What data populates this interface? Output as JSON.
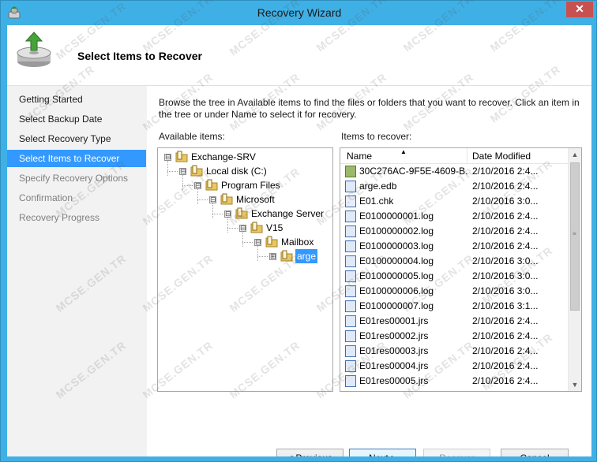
{
  "window": {
    "title": "Recovery Wizard",
    "close_symbol": "✕"
  },
  "header": {
    "title": "Select Items to Recover"
  },
  "nav": {
    "items": [
      {
        "label": "Getting Started",
        "state": "normal"
      },
      {
        "label": "Select Backup Date",
        "state": "normal"
      },
      {
        "label": "Select Recovery Type",
        "state": "normal"
      },
      {
        "label": "Select Items to Recover",
        "state": "active"
      },
      {
        "label": "Specify Recovery Options",
        "state": "disabled"
      },
      {
        "label": "Confirmation",
        "state": "disabled"
      },
      {
        "label": "Recovery Progress",
        "state": "disabled"
      }
    ]
  },
  "main": {
    "description": "Browse the tree in Available items to find the files or folders that you want to recover. Click an item in the tree or under Name to select it for recovery.",
    "available_label": "Available items:",
    "recover_label": "Items to recover:"
  },
  "tree": {
    "nodes": [
      {
        "label": "Exchange-SRV",
        "level": 0,
        "expander": "⊟"
      },
      {
        "label": "Local disk (C:)",
        "level": 1,
        "expander": "⊟"
      },
      {
        "label": "Program Files",
        "level": 2,
        "expander": "⊟"
      },
      {
        "label": "Microsoft",
        "level": 3,
        "expander": "⊟"
      },
      {
        "label": "Exchange Server",
        "level": 4,
        "expander": "⊟"
      },
      {
        "label": "V15",
        "level": 5,
        "expander": "⊟"
      },
      {
        "label": "Mailbox",
        "level": 6,
        "expander": "⊟"
      },
      {
        "label": "arge",
        "level": 7,
        "expander": "⊞",
        "selected": true
      }
    ]
  },
  "list": {
    "columns": {
      "name": "Name",
      "date": "Date Modified",
      "sort_indicator": "▲"
    },
    "rows": [
      {
        "name": "30C276AC-9F5E-4609-B...",
        "date": "2/10/2016 2:4...",
        "icon": "db"
      },
      {
        "name": "arge.edb",
        "date": "2/10/2016 2:4...",
        "icon": "file"
      },
      {
        "name": "E01.chk",
        "date": "2/10/2016 3:0...",
        "icon": "chk"
      },
      {
        "name": "E0100000001.log",
        "date": "2/10/2016 2:4...",
        "icon": "file"
      },
      {
        "name": "E0100000002.log",
        "date": "2/10/2016 2:4...",
        "icon": "file"
      },
      {
        "name": "E0100000003.log",
        "date": "2/10/2016 2:4...",
        "icon": "file"
      },
      {
        "name": "E0100000004.log",
        "date": "2/10/2016 3:0...",
        "icon": "file"
      },
      {
        "name": "E0100000005.log",
        "date": "2/10/2016 3:0...",
        "icon": "file"
      },
      {
        "name": "E0100000006.log",
        "date": "2/10/2016 3:0...",
        "icon": "file"
      },
      {
        "name": "E0100000007.log",
        "date": "2/10/2016 3:1...",
        "icon": "file"
      },
      {
        "name": "E01res00001.jrs",
        "date": "2/10/2016 2:4...",
        "icon": "file"
      },
      {
        "name": "E01res00002.jrs",
        "date": "2/10/2016 2:4...",
        "icon": "file"
      },
      {
        "name": "E01res00003.jrs",
        "date": "2/10/2016 2:4...",
        "icon": "file"
      },
      {
        "name": "E01res00004.jrs",
        "date": "2/10/2016 2:4...",
        "icon": "file"
      },
      {
        "name": "E01res00005.jrs",
        "date": "2/10/2016 2:4...",
        "icon": "file"
      }
    ],
    "scroll_up": "▲",
    "scroll_down": "▼",
    "grip": "≡"
  },
  "buttons": {
    "previous": "< Previous",
    "next": "Next >",
    "recover": "Recover",
    "cancel": "Cancel"
  },
  "watermark": "MCSE.GEN.TR",
  "colors": {
    "frame": "#3fb0e6",
    "selection": "#3399ff",
    "nav_bg": "#f2f2f2",
    "close": "#c75050"
  }
}
